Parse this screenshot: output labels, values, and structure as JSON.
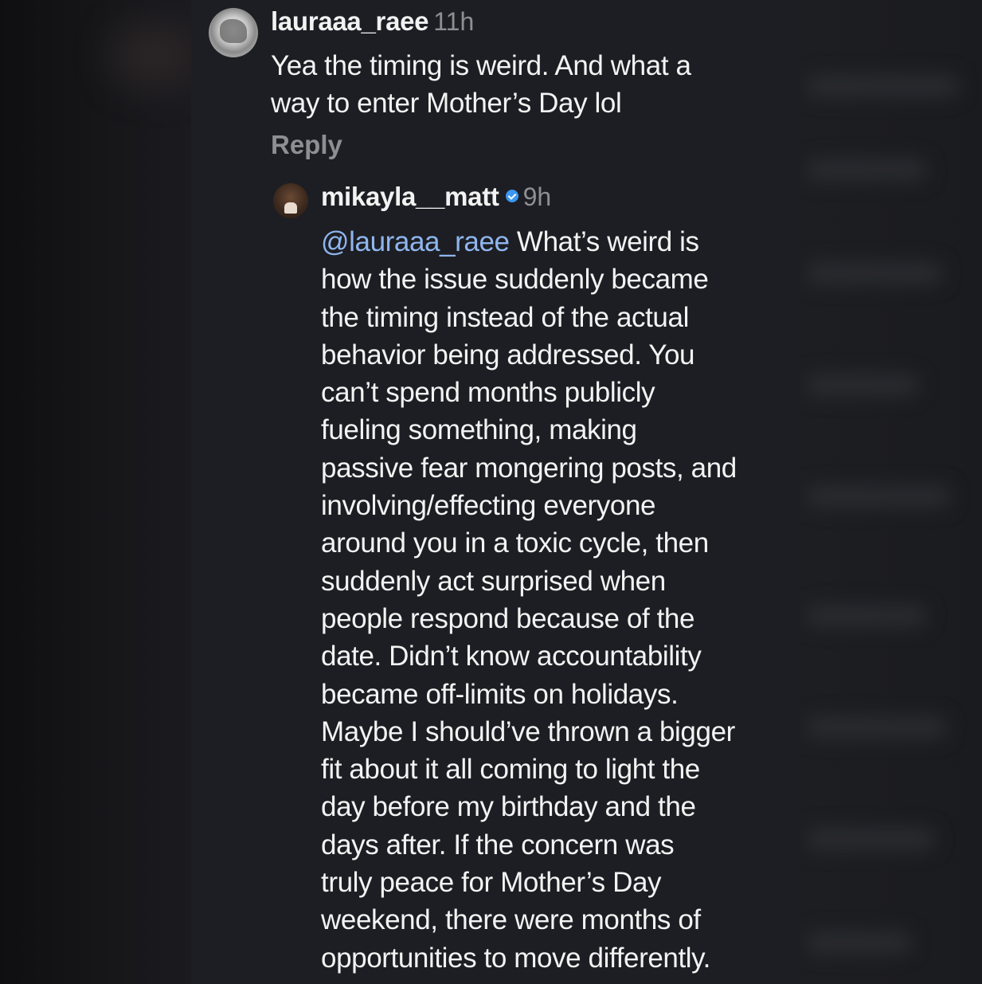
{
  "comments": [
    {
      "username": "lauraaa_raee",
      "time": "11h",
      "text_lines": [
        "Yea the timing is weird. And what a",
        "way to enter Mother’s Day lol"
      ],
      "reply_label": "Reply",
      "avatar_icon": "profile-photo"
    },
    {
      "username": "mikayla__matt",
      "verified": true,
      "time": "9h",
      "mention": "@lauraaa_raee",
      "first_line_rest": " What’s weird is",
      "text_lines": [
        "how the issue suddenly became",
        "the timing instead of the actual",
        "behavior being addressed. You",
        "can’t spend months publicly",
        "fueling something, making",
        "passive fear mongering posts, and",
        "involving/effecting everyone",
        "around you in a toxic cycle, then",
        "suddenly act surprised when",
        "people respond because of the",
        "date. Didn’t know  accountability",
        "became off-limits on holidays.",
        "Maybe I should’ve thrown a bigger",
        "fit about it all coming to light the",
        "day before my birthday and the",
        "days after.  If the concern was",
        "truly peace for Mother’s Day",
        "weekend, there were months of",
        "opportunities to move differently."
      ],
      "avatar_icon": "profile-photo"
    }
  ],
  "colors": {
    "background": "#1d1e23",
    "text": "#f3f3f3",
    "muted": "#8e8e93",
    "mention": "#8fb6ef",
    "verified_badge": "#3b97f0"
  }
}
